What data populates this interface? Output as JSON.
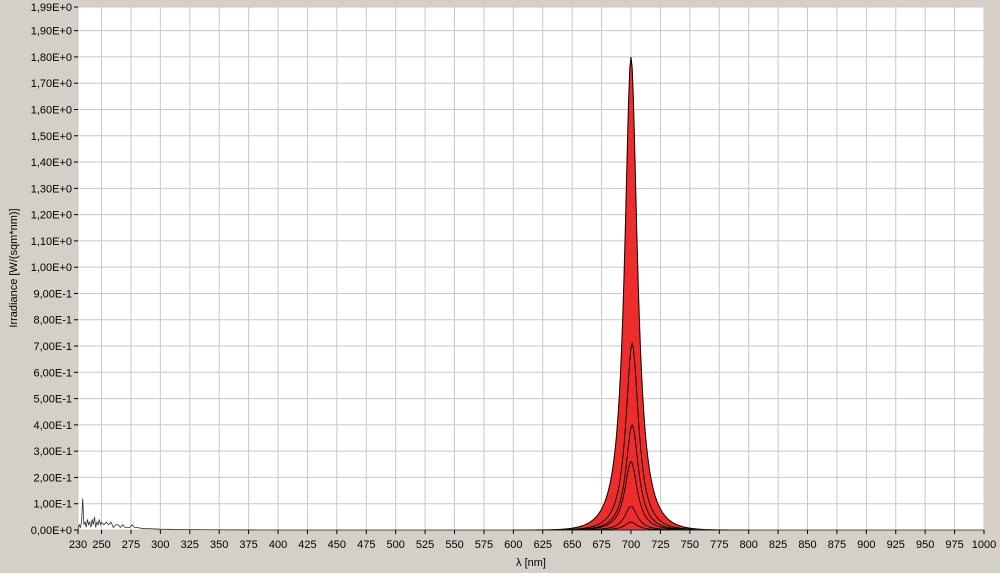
{
  "chart_data": {
    "type": "area",
    "title": "",
    "xlabel": "λ [nm]",
    "ylabel": "Irradiance [W/(sqm*nm)]",
    "xlim": [
      230,
      1000
    ],
    "ylim": [
      0,
      1.99
    ],
    "grid": true,
    "legend": "none",
    "x_ticks": [
      230,
      250,
      275,
      300,
      325,
      350,
      375,
      400,
      425,
      450,
      475,
      500,
      525,
      550,
      575,
      600,
      625,
      650,
      675,
      700,
      725,
      750,
      775,
      800,
      825,
      850,
      875,
      900,
      925,
      950,
      975,
      1000
    ],
    "y_ticks": [
      0,
      0.1,
      0.2,
      0.3,
      0.4,
      0.5,
      0.6,
      0.7,
      0.8,
      0.9,
      1.0,
      1.1,
      1.2,
      1.3,
      1.4,
      1.5,
      1.6,
      1.7,
      1.8,
      1.9,
      1.99
    ],
    "y_tick_labels": [
      "0,00E+0",
      "1,00E-1",
      "2,00E-1",
      "3,00E-1",
      "4,00E-1",
      "5,00E-1",
      "6,00E-1",
      "7,00E-1",
      "8,00E-1",
      "9,00E-1",
      "1,00E+0",
      "1,10E+0",
      "1,20E+0",
      "1,30E+0",
      "1,40E+0",
      "1,50E+0",
      "1,60E+0",
      "1,70E+0",
      "1,80E+0",
      "1,90E+0",
      "1,99E+0"
    ],
    "colors": {
      "fill": "#ee2c2c",
      "fill_light": "#f26060",
      "line": "#000000",
      "grid": "#c8c8c8",
      "plot_bg": "#ffffff",
      "frame_bg": "#d4d0c8"
    },
    "series": [
      {
        "peak_x": 700,
        "peak_y": 1.8
      },
      {
        "peak_x": 701,
        "peak_y": 0.71
      },
      {
        "peak_x": 701,
        "peak_y": 0.4
      },
      {
        "peak_x": 700,
        "peak_y": 0.26
      },
      {
        "peak_x": 700,
        "peak_y": 0.09
      },
      {
        "peak_x": 700,
        "peak_y": 0.03
      }
    ],
    "noise_points": [
      [
        230,
        0.0
      ],
      [
        231,
        0.02
      ],
      [
        232,
        0.01
      ],
      [
        233,
        0.03
      ],
      [
        234,
        0.12
      ],
      [
        235,
        0.02
      ],
      [
        236,
        0.03
      ],
      [
        237,
        0.01
      ],
      [
        238,
        0.04
      ],
      [
        239,
        0.02
      ],
      [
        240,
        0.03
      ],
      [
        241,
        0.01
      ],
      [
        242,
        0.04
      ],
      [
        243,
        0.02
      ],
      [
        244,
        0.05
      ],
      [
        245,
        0.01
      ],
      [
        246,
        0.03
      ],
      [
        247,
        0.02
      ],
      [
        248,
        0.04
      ],
      [
        249,
        0.02
      ],
      [
        250,
        0.03
      ],
      [
        252,
        0.02
      ],
      [
        254,
        0.03
      ],
      [
        256,
        0.02
      ],
      [
        258,
        0.03
      ],
      [
        260,
        0.01
      ],
      [
        262,
        0.02
      ],
      [
        264,
        0.02
      ],
      [
        266,
        0.01
      ],
      [
        268,
        0.02
      ],
      [
        270,
        0.01
      ],
      [
        272,
        0.01
      ],
      [
        274,
        0.01
      ],
      [
        276,
        0.02
      ],
      [
        278,
        0.01
      ],
      [
        280,
        0.01
      ],
      [
        285,
        0.005
      ],
      [
        290,
        0.005
      ],
      [
        300,
        0.003
      ],
      [
        320,
        0.002
      ],
      [
        340,
        0.001
      ],
      [
        400,
        0.0
      ]
    ]
  }
}
